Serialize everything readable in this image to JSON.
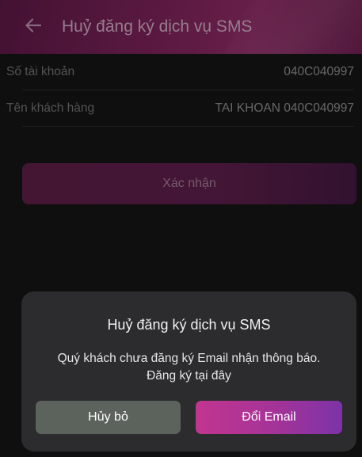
{
  "header": {
    "title": "Huỷ đăng ký dịch vụ SMS",
    "back_icon": "arrow-left-icon"
  },
  "info": {
    "rows": [
      {
        "label": "Số tài khoản",
        "value": "040C040997"
      },
      {
        "label": "Tên khách hàng",
        "value": "TAI KHOAN 040C040997"
      }
    ]
  },
  "confirm_label": "Xác nhận",
  "dialog": {
    "title": "Huỷ đăng ký dịch vụ SMS",
    "message_line1": "Quý khách chưa đăng ký Email nhận thông báo.",
    "message_line2": "Đăng ký tại đây",
    "cancel_label": "Hủy bỏ",
    "change_email_label": "Đổi Email"
  },
  "colors": {
    "header_gradient_start": "#5a1844",
    "header_gradient_end": "#8a2a63",
    "background": "#141414",
    "dialog_background": "#2c2c2e",
    "cancel_button": "#5c625c",
    "primary_gradient_start": "#c2358f",
    "primary_gradient_end": "#7c33a8"
  }
}
